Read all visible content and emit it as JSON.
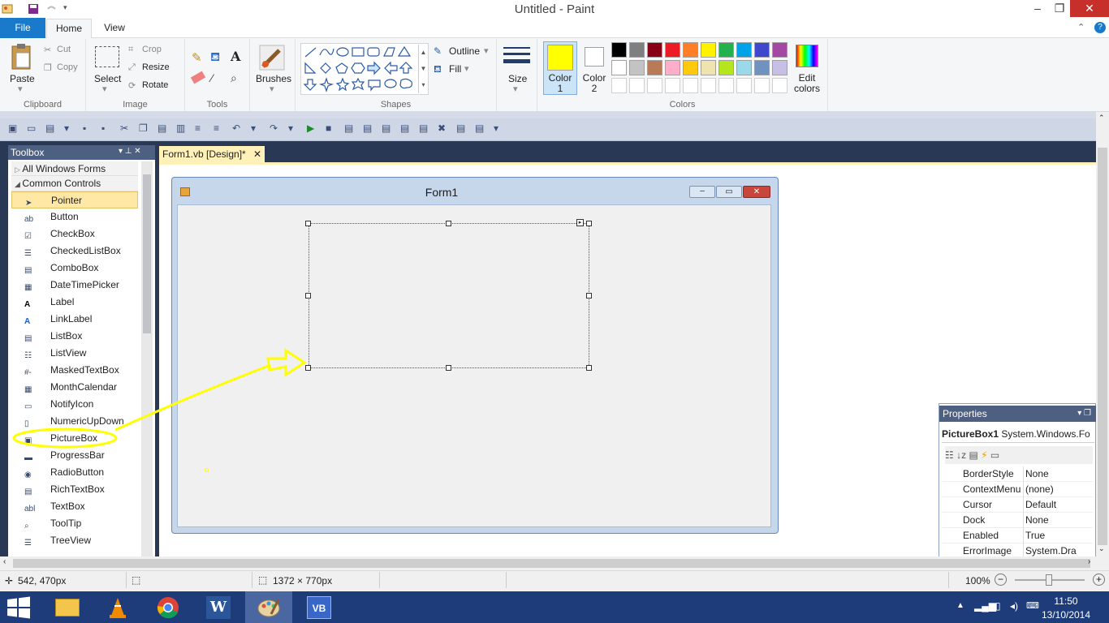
{
  "window": {
    "title": "Untitled - Paint"
  },
  "ribbon": {
    "tabs": {
      "file": "File",
      "home": "Home",
      "view": "View"
    },
    "clipboard": {
      "label": "Clipboard",
      "paste": "Paste",
      "cut": "Cut",
      "copy": "Copy"
    },
    "image": {
      "label": "Image",
      "select": "Select",
      "crop": "Crop",
      "resize": "Resize",
      "rotate": "Rotate"
    },
    "tools": {
      "label": "Tools"
    },
    "brushes": {
      "label": "Brushes"
    },
    "shapes": {
      "label": "Shapes",
      "outline": "Outline",
      "fill": "Fill"
    },
    "size": {
      "label": "Size"
    },
    "colors": {
      "label": "Colors",
      "color1": "Color 1",
      "color1_value": "#ffff00",
      "color2": "Color 2",
      "color2_value": "#ffffff",
      "edit_colors": "Edit colors",
      "palette_row1": [
        "#000000",
        "#7f7f7f",
        "#880015",
        "#ed1c24",
        "#ff7f27",
        "#fff200",
        "#22b14c",
        "#00a2e8",
        "#3f48cc",
        "#a349a4"
      ],
      "palette_row2": [
        "#ffffff",
        "#c3c3c3",
        "#b97a57",
        "#ffaec9",
        "#ffc90e",
        "#efe4b0",
        "#b5e61d",
        "#99d9ea",
        "#7092be",
        "#c8bfe7"
      ]
    }
  },
  "vs": {
    "toolbox": {
      "title": "Toolbox",
      "section_all": "All Windows Forms",
      "section_common": "Common Controls",
      "items": [
        "Pointer",
        "Button",
        "CheckBox",
        "CheckedListBox",
        "ComboBox",
        "DateTimePicker",
        "Label",
        "LinkLabel",
        "ListBox",
        "ListView",
        "MaskedTextBox",
        "MonthCalendar",
        "NotifyIcon",
        "NumericUpDown",
        "PictureBox",
        "ProgressBar",
        "RadioButton",
        "RichTextBox",
        "TextBox",
        "ToolTip",
        "TreeView"
      ]
    },
    "doc_tab": "Form1.vb [Design]*",
    "form_title": "Form1",
    "properties": {
      "title": "Properties",
      "object": "PictureBox1",
      "object_type": "System.Windows.Fo",
      "rows": [
        {
          "k": "BorderStyle",
          "v": "None"
        },
        {
          "k": "ContextMenu",
          "v": "(none)"
        },
        {
          "k": "Cursor",
          "v": "Default"
        },
        {
          "k": "Dock",
          "v": "None"
        },
        {
          "k": "Enabled",
          "v": "True"
        },
        {
          "k": "ErrorImage",
          "v": "System.Dra"
        }
      ]
    }
  },
  "statusbar": {
    "cursor_pos": "542, 470px",
    "canvas_size": "1372 × 770px",
    "zoom": "100%"
  },
  "taskbar": {
    "time": "11:50",
    "date": "13/10/2014"
  },
  "colors": {
    "accent": "#1979ca",
    "highlight": "#ffff00",
    "vs_navy": "#293955"
  }
}
